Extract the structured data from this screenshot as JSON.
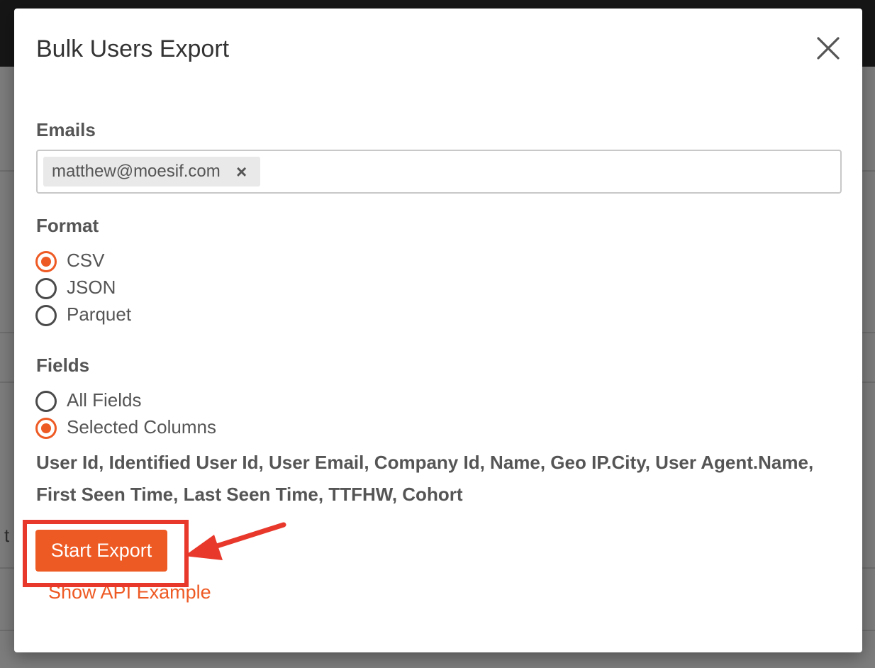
{
  "modal": {
    "title": "Bulk Users Export"
  },
  "emails": {
    "label": "Emails",
    "tags": [
      {
        "value": "matthew@moesif.com",
        "remove_glyph": "×"
      }
    ]
  },
  "format": {
    "label": "Format",
    "options": [
      {
        "label": "CSV",
        "checked": true
      },
      {
        "label": "JSON",
        "checked": false
      },
      {
        "label": "Parquet",
        "checked": false
      }
    ]
  },
  "fields": {
    "label": "Fields",
    "options": [
      {
        "label": "All Fields",
        "checked": false
      },
      {
        "label": "Selected Columns",
        "checked": true
      }
    ],
    "selected_columns_text": "User Id, Identified User Id, User Email, Company Id, Name, Geo IP.City, User Agent.Name, First Seen Time, Last Seen Time, TTFHW, Cohort"
  },
  "actions": {
    "start_export_label": "Start Export",
    "show_api_label": "Show API Example"
  },
  "background": {
    "partial_text": "t"
  },
  "icons": {
    "close": "close-icon",
    "tag_remove": "remove-tag-icon",
    "annotation_arrow": "arrow-left-icon"
  },
  "colors": {
    "accent": "#ee5a24",
    "annotation": "#e8382c",
    "text": "#555555",
    "title": "#333333",
    "overlay": "#7d7d7d",
    "topbar": "#161616"
  }
}
